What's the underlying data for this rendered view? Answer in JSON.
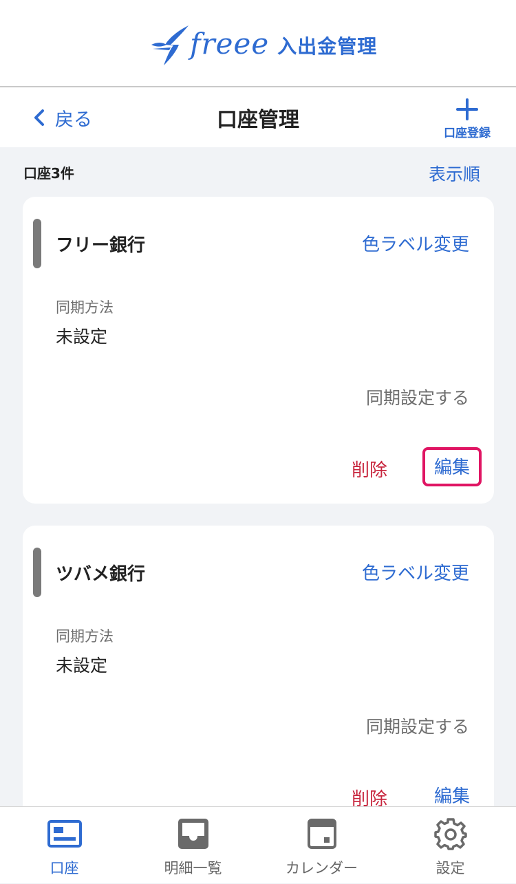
{
  "header": {
    "logo_word": "freee",
    "logo_suffix": "入出金管理"
  },
  "nav": {
    "back_label": "戻る",
    "title": "口座管理",
    "add_label": "口座登録"
  },
  "summary": {
    "count_label": "口座3件",
    "sort_label": "表示順"
  },
  "accounts": [
    {
      "name": "フリー銀行",
      "color_label_link": "色ラベル変更",
      "sync_method_label": "同期方法",
      "sync_method_value": "未設定",
      "sync_setting_link": "同期設定する",
      "delete_label": "削除",
      "edit_label": "編集",
      "label_color": "#7a7a7a"
    },
    {
      "name": "ツバメ銀行",
      "color_label_link": "色ラベル変更",
      "sync_method_label": "同期方法",
      "sync_method_value": "未設定",
      "sync_setting_link": "同期設定する",
      "delete_label": "削除",
      "edit_label": "編集",
      "label_color": "#7a7a7a"
    }
  ],
  "tabs": [
    {
      "label": "口座",
      "icon": "bank-card-icon",
      "active": true
    },
    {
      "label": "明細一覧",
      "icon": "inbox-tray-icon",
      "active": false
    },
    {
      "label": "カレンダー",
      "icon": "calendar-icon",
      "active": false
    },
    {
      "label": "設定",
      "icon": "gear-icon",
      "active": false
    }
  ],
  "colors": {
    "accent": "#2e6bd1",
    "danger": "#c8263e",
    "highlight": "#e01563",
    "background": "#f1f3f6"
  }
}
